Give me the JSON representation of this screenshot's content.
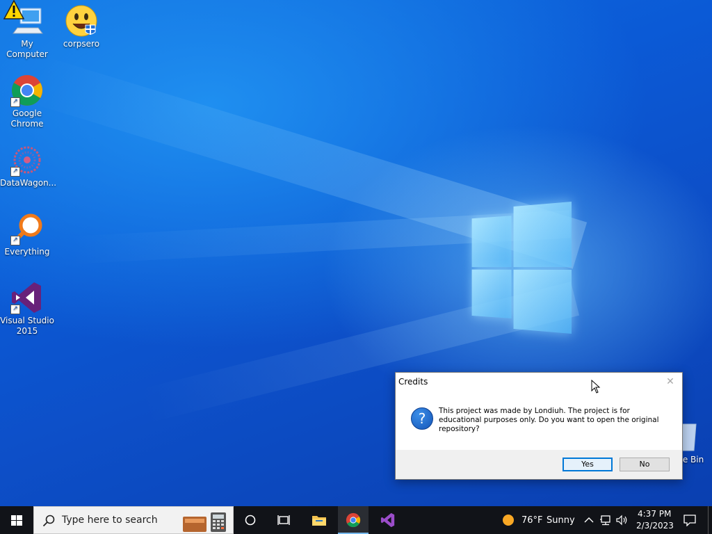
{
  "desktop": {
    "icons": [
      {
        "label": "My Computer",
        "icon": "computer-icon"
      },
      {
        "label": "corpsero",
        "icon": "smiley-icon"
      },
      {
        "label": "Google Chrome",
        "icon": "chrome-icon"
      },
      {
        "label": "DataWagon...",
        "icon": "datawagon-icon"
      },
      {
        "label": "Everything",
        "icon": "everything-search-icon"
      },
      {
        "label": "Visual Studio 2015",
        "icon": "visual-studio-icon"
      },
      {
        "label": "e Bin",
        "icon": "recycle-bin-icon"
      }
    ]
  },
  "dialog": {
    "title": "Credits",
    "message": "This project was made by Londiuh. The project is for educational purposes only. Do you want to open the original repository?",
    "yes_label": "Yes",
    "no_label": "No",
    "icon": "question-icon"
  },
  "taskbar": {
    "search_placeholder": "Type here to search",
    "weather_temp": "76°F",
    "weather_desc": "Sunny",
    "time": "4:37 PM",
    "date": "2/3/2023"
  },
  "colors": {
    "accent": "#0078d7",
    "taskbar": "#111318"
  }
}
